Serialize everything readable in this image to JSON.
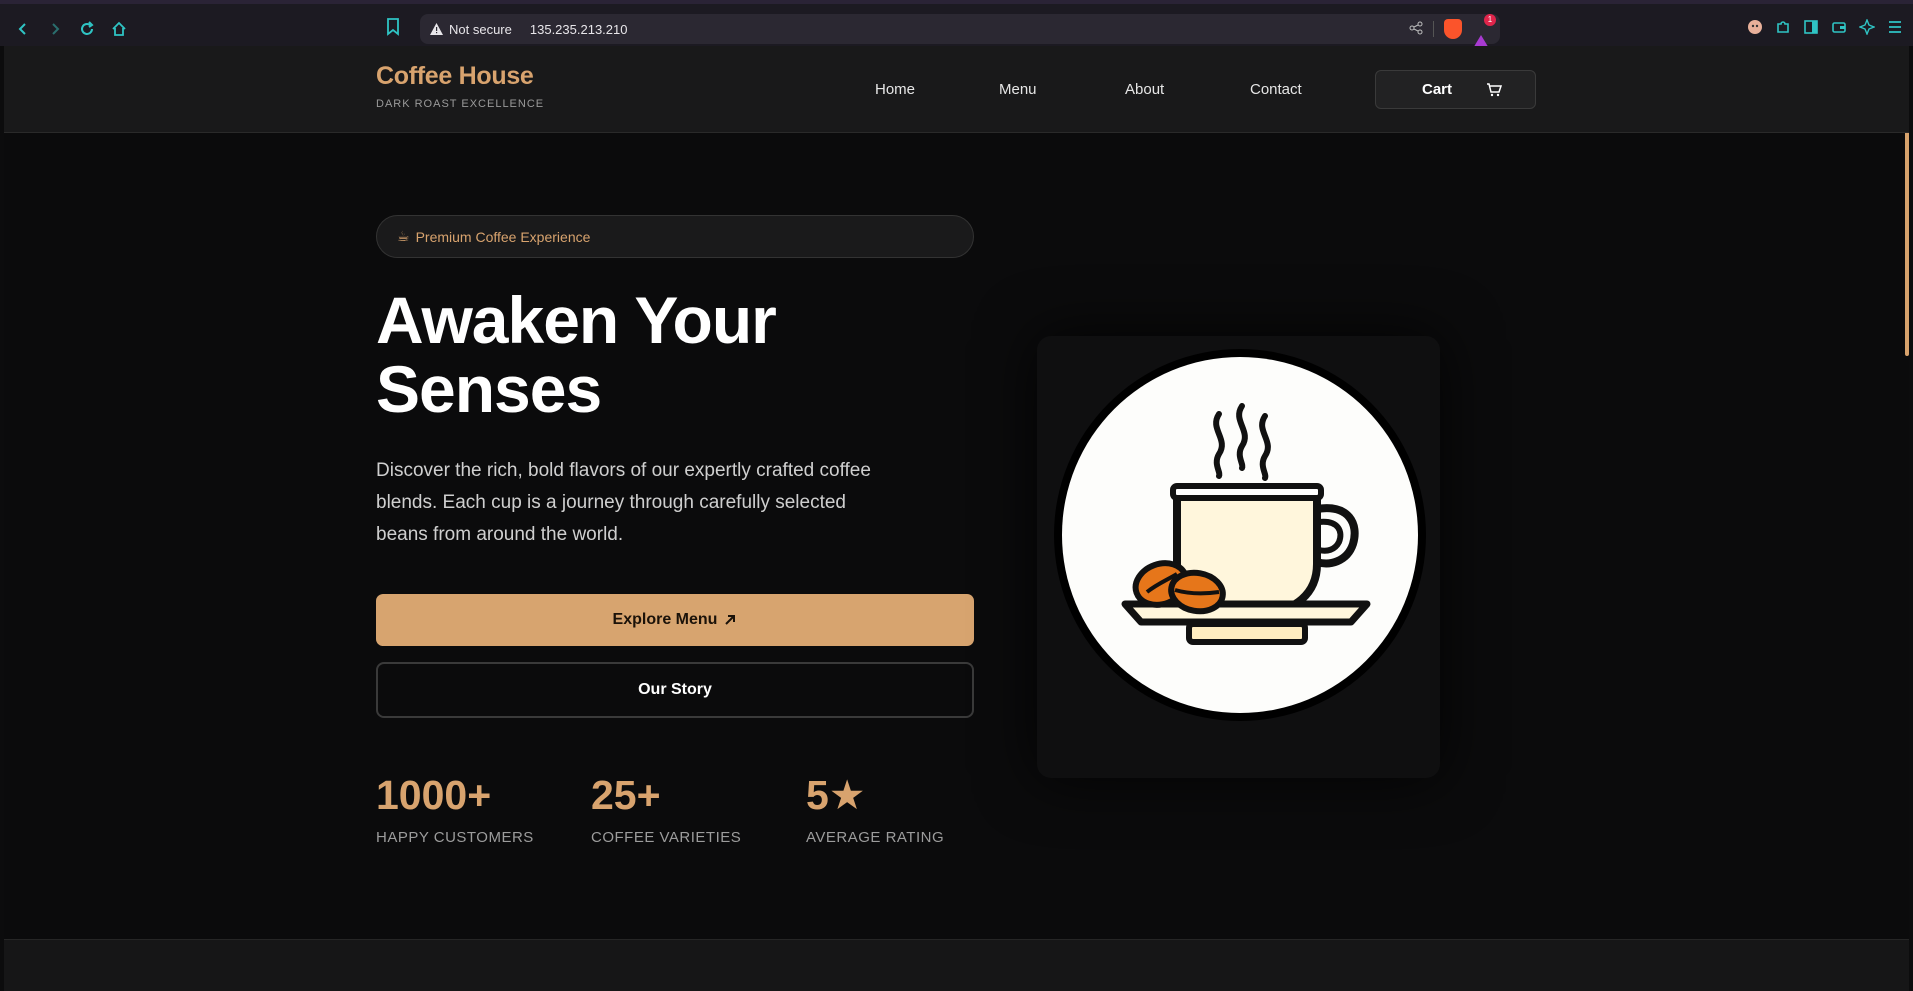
{
  "browser": {
    "security_label": "Not secure",
    "url": "135.235.213.210",
    "rewards_badge": "1"
  },
  "site": {
    "brand": "Coffee House",
    "tagline": "DARK ROAST EXCELLENCE",
    "nav": [
      "Home",
      "Menu",
      "About",
      "Contact"
    ],
    "cart_label": "Cart"
  },
  "hero": {
    "pill": "Premium Coffee Experience",
    "pill_icon": "☕",
    "title_line1": "Awaken Your",
    "title_line2": "Senses",
    "description": "Discover the rich, bold flavors of our expertly crafted coffee blends. Each cup is a journey through carefully selected beans from around the world.",
    "primary_button": "Explore Menu",
    "secondary_button": "Our Story"
  },
  "stats": [
    {
      "value": "1000+",
      "label": "HAPPY CUSTOMERS"
    },
    {
      "value": "25+",
      "label": "COFFEE VARIETIES"
    },
    {
      "value": "5★",
      "label": "AVERAGE RATING"
    }
  ],
  "colors": {
    "accent": "#d8a36e",
    "background": "#0b0b0c",
    "header": "#19191a"
  }
}
